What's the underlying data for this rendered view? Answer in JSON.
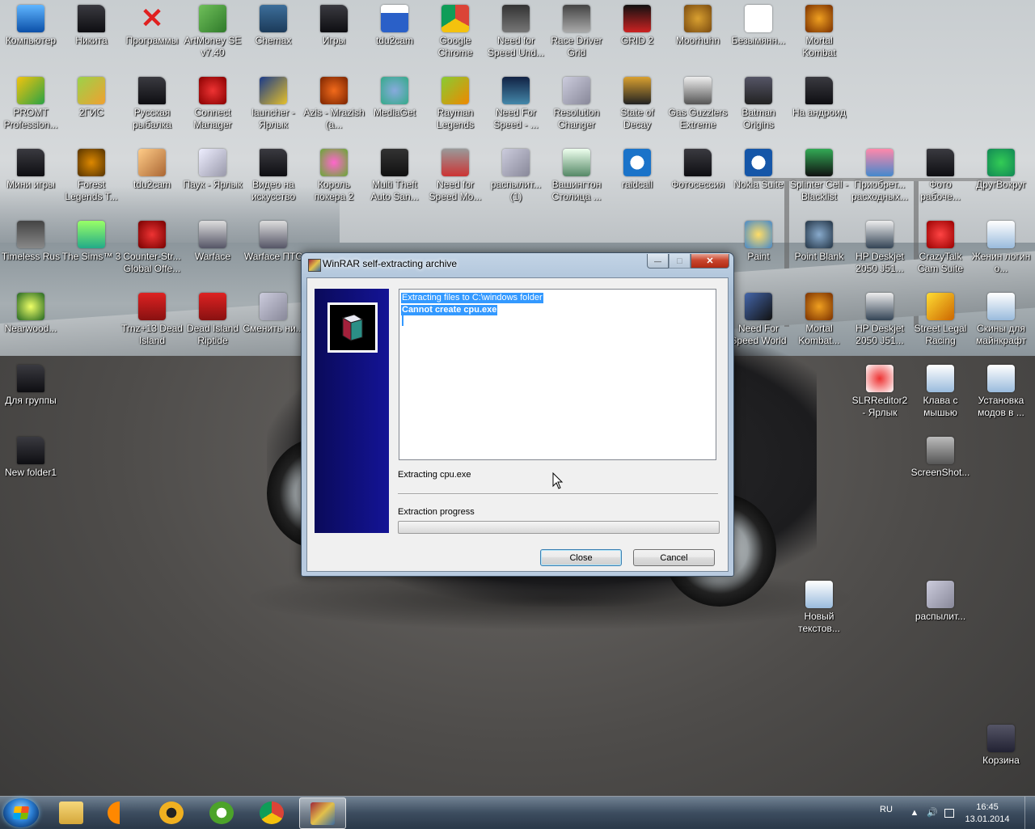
{
  "desktop": {
    "icons": [
      {
        "label": "Компьютер",
        "kind": "computer"
      },
      {
        "label": "Никита",
        "kind": "folder"
      },
      {
        "label": "Программы",
        "kind": "red-x"
      },
      {
        "label": "ArtMoney SE v7.40",
        "kind": "money"
      },
      {
        "label": "Chemax",
        "kind": "chemax"
      },
      {
        "label": "Игры",
        "kind": "folder"
      },
      {
        "label": "tdu2cam",
        "kind": "app-window"
      },
      {
        "label": "Google Chrome",
        "kind": "chrome"
      },
      {
        "label": "Need for Speed Und...",
        "kind": "nfs"
      },
      {
        "label": "Race Driver Grid",
        "kind": "grid"
      },
      {
        "label": "GRID 2",
        "kind": "grid2"
      },
      {
        "label": "Moorhuhn",
        "kind": "moorhuhn"
      },
      {
        "label": "Безымянн...",
        "kind": "doc"
      },
      {
        "label": "Mortal Kombat",
        "kind": "mk"
      },
      {
        "label": "PROMT Profession...",
        "kind": "promt"
      },
      {
        "label": "2ГИС",
        "kind": "2gis"
      },
      {
        "label": "Русская рыбалка",
        "kind": "folder"
      },
      {
        "label": "Connect Manager",
        "kind": "connect"
      },
      {
        "label": "launcher - Ярлык",
        "kind": "launcher"
      },
      {
        "label": "Azis - Mrazish (a...",
        "kind": "mp3"
      },
      {
        "label": "MediaGet",
        "kind": "mediaget"
      },
      {
        "label": "Rayman Legends",
        "kind": "rayman"
      },
      {
        "label": "Need For Speed - ...",
        "kind": "nfs2"
      },
      {
        "label": "Resolution Changer",
        "kind": "gear"
      },
      {
        "label": "State of Decay",
        "kind": "sod"
      },
      {
        "label": "Gas Guzzlers Extreme",
        "kind": "gas"
      },
      {
        "label": "Batman Origins",
        "kind": "batman"
      },
      {
        "label": "На андроид",
        "kind": "folder"
      },
      {
        "label": "Мини игры",
        "kind": "folder"
      },
      {
        "label": "Forest Legends T...",
        "kind": "forest"
      },
      {
        "label": "tdu2cam",
        "kind": "tdu"
      },
      {
        "label": "Паук - Ярлык",
        "kind": "spider"
      },
      {
        "label": "Видео на искусство",
        "kind": "folder"
      },
      {
        "label": "Король покера 2",
        "kind": "poker"
      },
      {
        "label": "Multi Theft Auto San...",
        "kind": "mta"
      },
      {
        "label": "Need for Speed Mo...",
        "kind": "nfsmw"
      },
      {
        "label": "распылит... (1)",
        "kind": "gear"
      },
      {
        "label": "Вашингтон Столица ...",
        "kind": "washington"
      },
      {
        "label": "raidcall",
        "kind": "raidcall"
      },
      {
        "label": "Фотосессия",
        "kind": "folder"
      },
      {
        "label": "Nokia Suite",
        "kind": "nokia"
      },
      {
        "label": "Splinter Cell - Blacklist",
        "kind": "splinter"
      },
      {
        "label": "Приобрет... расходных...",
        "kind": "printer"
      },
      {
        "label": "Фото рабоче...",
        "kind": "folder"
      },
      {
        "label": "ДругВокруг",
        "kind": "clover"
      },
      {
        "label": "Timeless Rus",
        "kind": "timeless"
      },
      {
        "label": "The Sims™ 3",
        "kind": "sims"
      },
      {
        "label": "Counter-Str... Global Offe...",
        "kind": "cs"
      },
      {
        "label": "Warface",
        "kind": "warface"
      },
      {
        "label": "Warface ПТС",
        "kind": "warface"
      },
      {
        "label": "Paint",
        "kind": "paint"
      },
      {
        "label": "Point Blank",
        "kind": "pointblank"
      },
      {
        "label": "HP Deskjet 2050 J51...",
        "kind": "scanner"
      },
      {
        "label": "CrazyTalk Cam Suite",
        "kind": "crazytalk"
      },
      {
        "label": "Женин логин о...",
        "kind": "doc-blue"
      },
      {
        "label": "Nearwood...",
        "kind": "nearwood"
      },
      {
        "label": "Trnz+13 Dead Island",
        "kind": "deadisland"
      },
      {
        "label": "Dead Island Riptide",
        "kind": "deadisland"
      },
      {
        "label": "Сменить ни...",
        "kind": "gear"
      },
      {
        "label": "Need For Speed World",
        "kind": "nfsworld"
      },
      {
        "label": "Mortal Kombat...",
        "kind": "mk"
      },
      {
        "label": "HP Deskjet 2050 J51...",
        "kind": "scanner"
      },
      {
        "label": "Street Legal Racing",
        "kind": "slr"
      },
      {
        "label": "Скины для майнкрафт",
        "kind": "doc-blue"
      },
      {
        "label": "Для группы",
        "kind": "folder"
      },
      {
        "label": "SLRReditor2 - Ярлык",
        "kind": "slreditor"
      },
      {
        "label": "Клава с мышью",
        "kind": "doc-blue"
      },
      {
        "label": "Установка модов в ...",
        "kind": "doc-blue"
      },
      {
        "label": "New folder1",
        "kind": "folder"
      },
      {
        "label": "ScreenShot...",
        "kind": "screenshot"
      },
      {
        "label": "Новый текстов...",
        "kind": "doc-blue"
      },
      {
        "label": "распылит...",
        "kind": "gear"
      },
      {
        "label": "Корзина",
        "kind": "recycle"
      }
    ]
  },
  "dialog": {
    "title": "WinRAR self-extracting archive",
    "log_lines": [
      "Extracting files to C:\\windows folder",
      "Cannot create cpu.exe"
    ],
    "status_text": "Extracting cpu.exe",
    "progress_label": "Extraction progress",
    "progress_value": 0,
    "close_label": "Close",
    "cancel_label": "Cancel",
    "caption_minimize": "—",
    "caption_maximize": "□",
    "caption_close": "✕"
  },
  "taskbar": {
    "pinned": [
      {
        "name": "explorer",
        "icon": "folder-icon"
      },
      {
        "name": "vlc",
        "icon": "vlc-icon"
      },
      {
        "name": "daemon-tools",
        "icon": "daemon-tools-icon"
      },
      {
        "name": "utorrent",
        "icon": "utorrent-icon"
      },
      {
        "name": "chrome",
        "icon": "chrome-icon"
      },
      {
        "name": "winrar",
        "icon": "winrar-icon",
        "active": true
      }
    ],
    "language": "RU",
    "time": "16:45",
    "date": "13.01.2014"
  },
  "colors": {
    "banner_blue": "#141496",
    "selection": "#3399ff",
    "close_red": "#c9472f"
  }
}
